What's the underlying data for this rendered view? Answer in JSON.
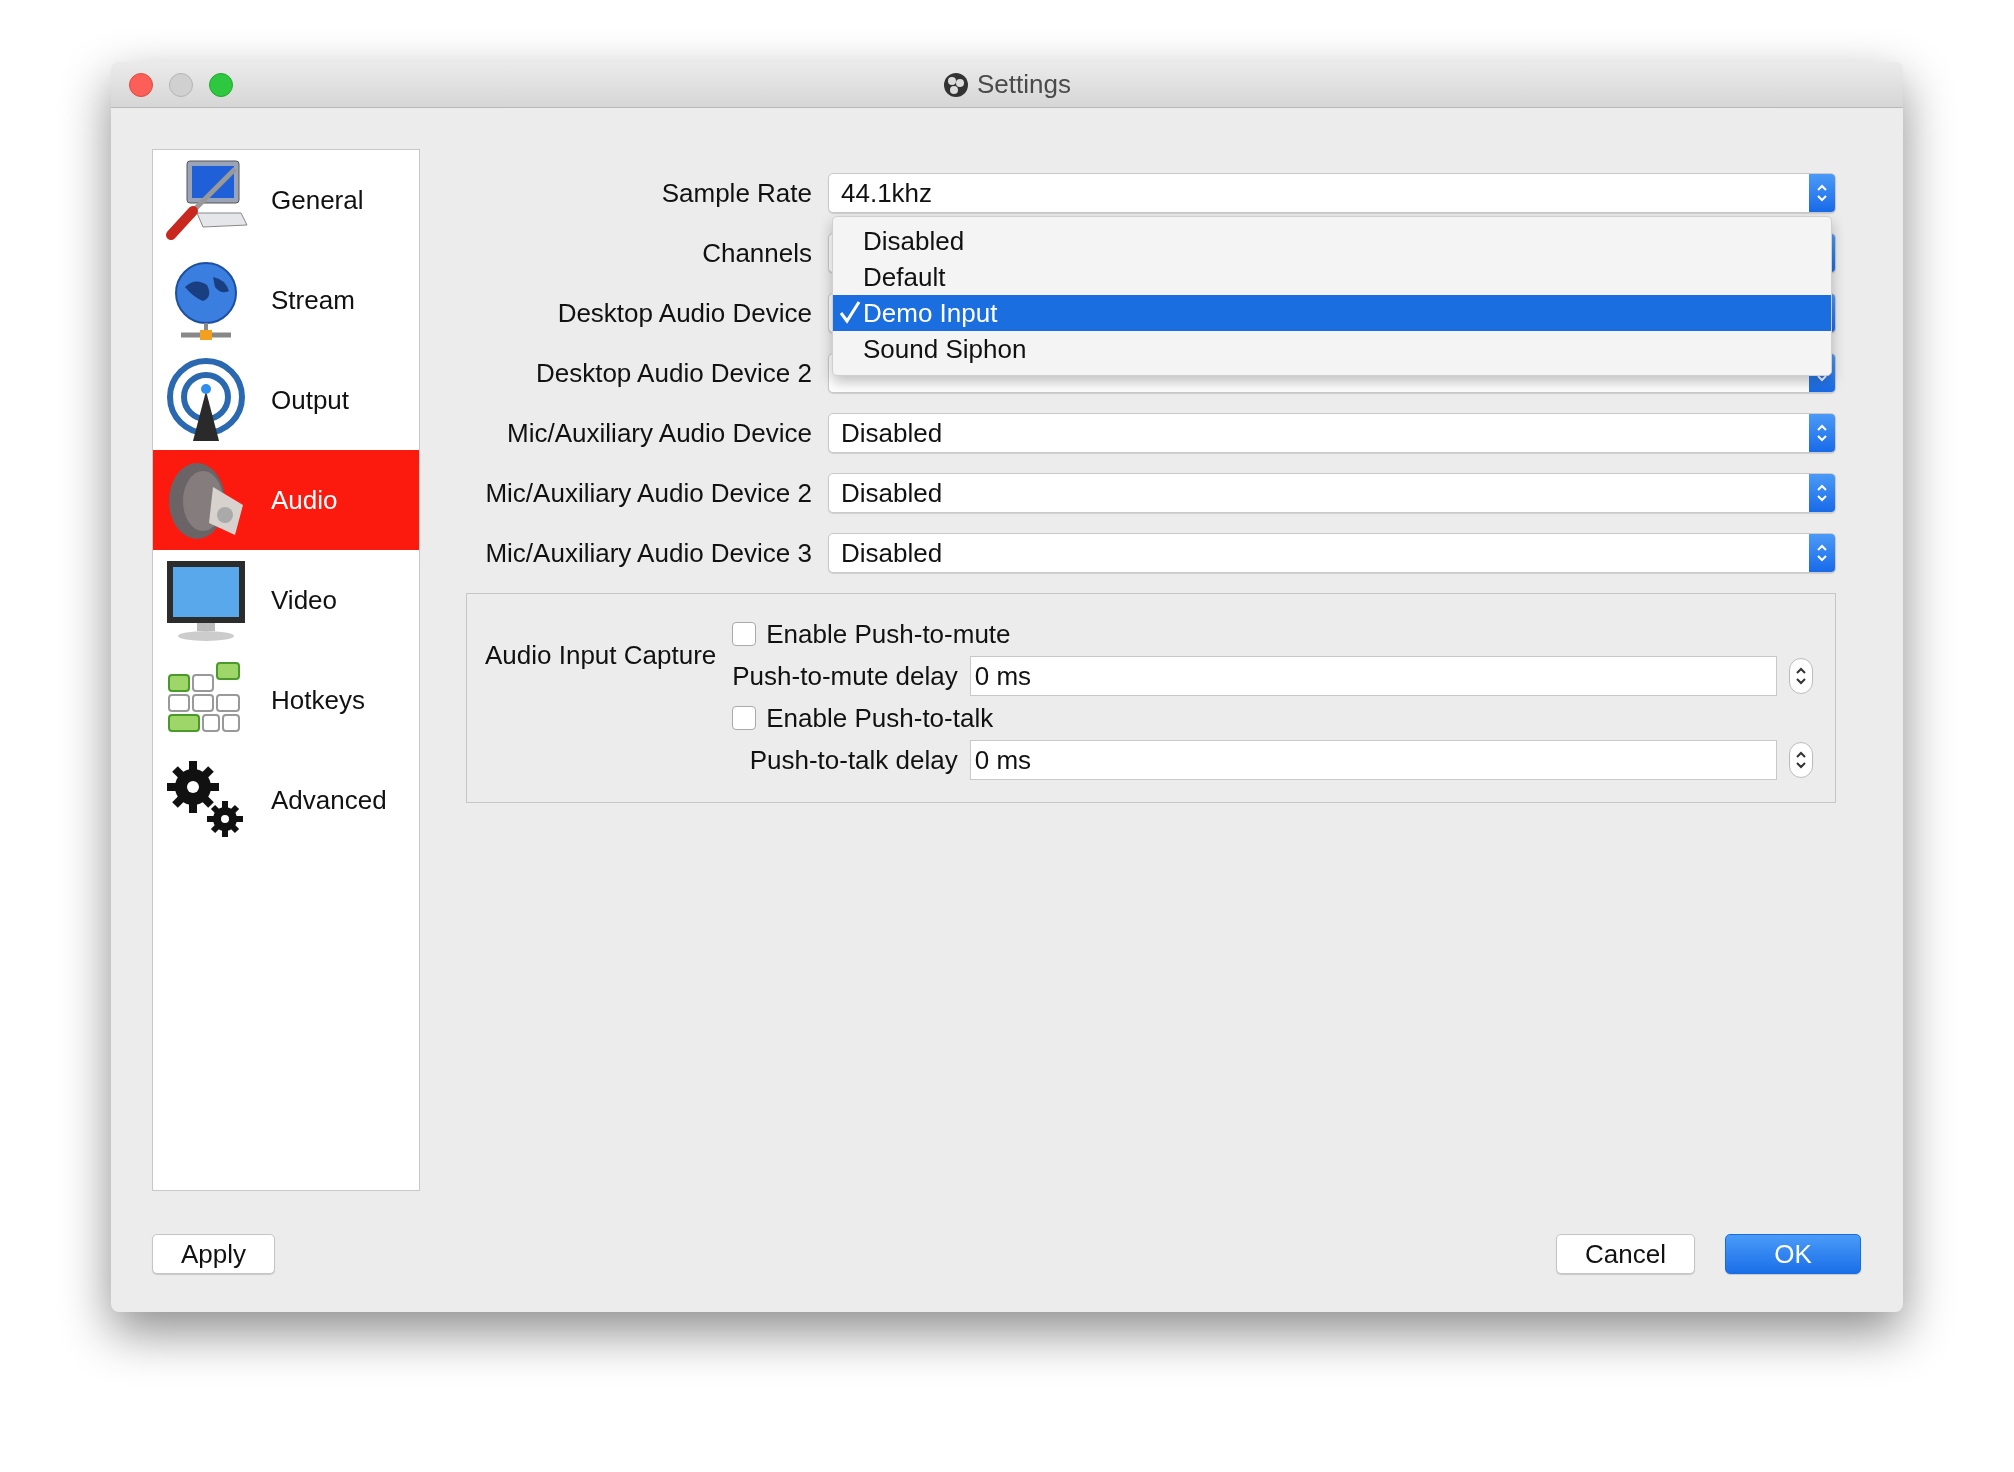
{
  "window": {
    "title": "Settings"
  },
  "sidebar": {
    "items": [
      {
        "label": "General",
        "selected": false
      },
      {
        "label": "Stream",
        "selected": false
      },
      {
        "label": "Output",
        "selected": false
      },
      {
        "label": "Audio",
        "selected": true
      },
      {
        "label": "Video",
        "selected": false
      },
      {
        "label": "Hotkeys",
        "selected": false
      },
      {
        "label": "Advanced",
        "selected": false
      }
    ]
  },
  "fields": [
    {
      "label": "Sample Rate",
      "value": "44.1khz"
    },
    {
      "label": "Channels"
    },
    {
      "label": "Desktop Audio Device"
    },
    {
      "label": "Desktop Audio Device 2"
    },
    {
      "label": "Mic/Auxiliary Audio Device",
      "value": "Disabled"
    },
    {
      "label": "Mic/Auxiliary Audio Device 2",
      "value": "Disabled"
    },
    {
      "label": "Mic/Auxiliary Audio Device 3",
      "value": "Disabled"
    }
  ],
  "dropdown": {
    "items": [
      {
        "label": "Disabled",
        "selected": false
      },
      {
        "label": "Default",
        "selected": false
      },
      {
        "label": "Demo Input",
        "selected": true
      },
      {
        "label": "Sound Siphon",
        "selected": false
      }
    ]
  },
  "audio_input_capture": {
    "title": "Audio Input Capture",
    "rows": [
      {
        "kind": "checkbox",
        "label": "Enable Push-to-mute",
        "checked": false
      },
      {
        "kind": "spin",
        "label": "Push-to-mute delay",
        "value": "0 ms"
      },
      {
        "kind": "checkbox",
        "label": "Enable Push-to-talk",
        "checked": false
      },
      {
        "kind": "spin",
        "label": "Push-to-talk delay",
        "value": "0 ms"
      }
    ]
  },
  "buttons": [
    {
      "label": "Apply",
      "kind": "plain"
    },
    {
      "label": "Cancel",
      "kind": "plain"
    },
    {
      "label": "OK",
      "kind": "primary"
    }
  ]
}
